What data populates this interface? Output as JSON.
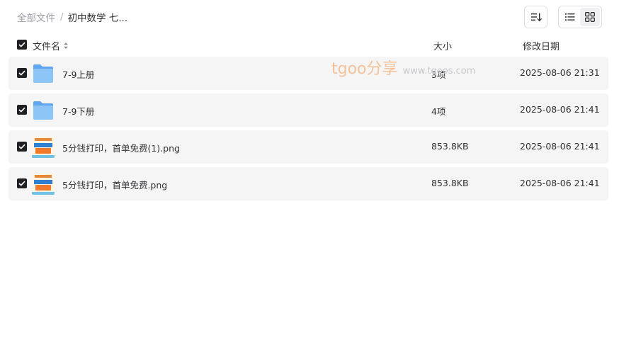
{
  "breadcrumb": {
    "root": "全部文件",
    "separator": "/",
    "current": "初中数学 七..."
  },
  "toolbar": {
    "sort_icon": "sort-icon",
    "view_list_icon": "list-view-icon",
    "view_grid_icon": "grid-view-icon"
  },
  "header": {
    "name": "文件名",
    "size": "大小",
    "date": "修改日期"
  },
  "files": [
    {
      "name": "7-9上册",
      "size": "3项",
      "date": "2025-08-06 21:31",
      "type": "folder",
      "checked": true
    },
    {
      "name": "7-9下册",
      "size": "4项",
      "date": "2025-08-06 21:41",
      "type": "folder",
      "checked": true
    },
    {
      "name": "5分钱打印，首单免费(1).png",
      "size": "853.8KB",
      "date": "2025-08-06 21:41",
      "type": "image",
      "checked": true
    },
    {
      "name": "5分钱打印，首单免费.png",
      "size": "853.8KB",
      "date": "2025-08-06 21:41",
      "type": "image",
      "checked": true
    }
  ],
  "watermark": {
    "brand": "tgoo分享",
    "site": "www.tgoos.com"
  },
  "colors": {
    "checkbox": "#1f2024",
    "row_bg": "#f5f5f6",
    "folder": "#7ab8f5"
  }
}
